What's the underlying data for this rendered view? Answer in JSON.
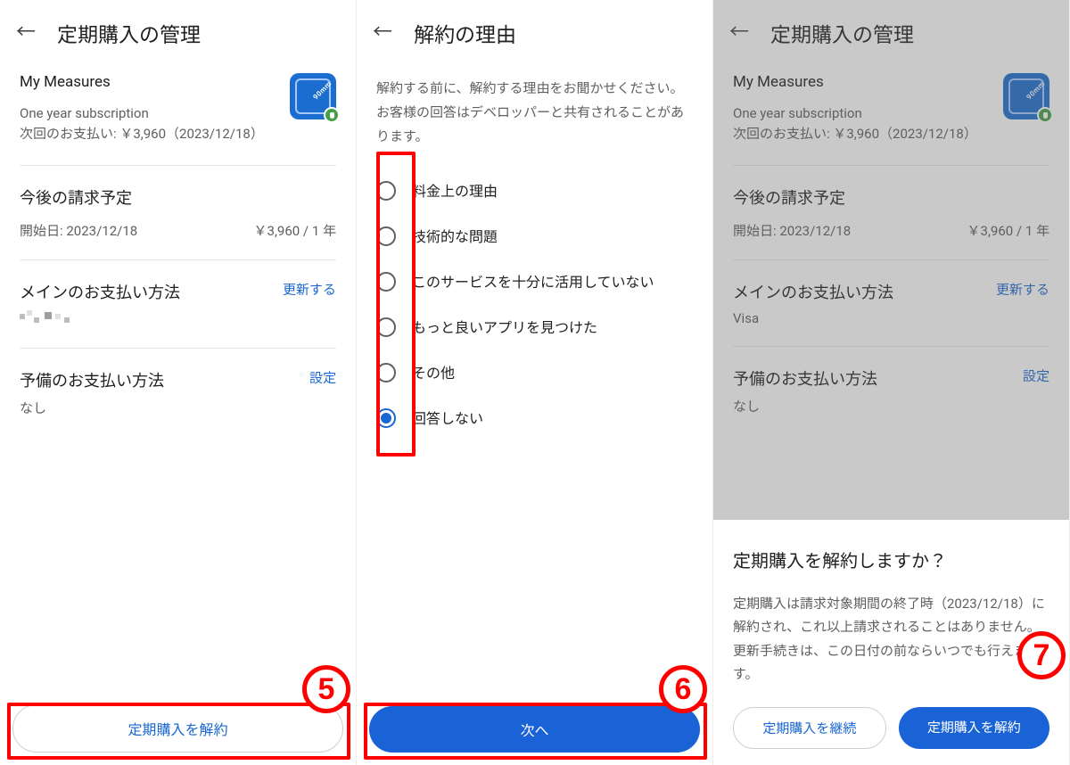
{
  "screen1": {
    "header_title": "定期購入の管理",
    "app_name": "My Measures",
    "app_sub1": "One year subscription",
    "app_sub2": "次回のお支払い: ￥3,960（2023/12/18）",
    "billing_title": "今後の請求予定",
    "billing_start_label": "開始日: 2023/12/18",
    "billing_price": "￥3,960 / 1 年",
    "payment_title": "メインのお支払い方法",
    "payment_update": "更新する",
    "backup_title": "予備のお支払い方法",
    "backup_value": "なし",
    "backup_set": "設定",
    "cancel_btn": "定期購入を解約",
    "callout_number": "5"
  },
  "screen2": {
    "header_title": "解約の理由",
    "desc": "解約する前に、解約する理由をお聞かせください。お客様の回答はデベロッパーと共有されることがあります。",
    "options": [
      "料金上の理由",
      "技術的な問題",
      "このサービスを十分に活用していない",
      "もっと良いアプリを見つけた",
      "その他",
      "回答しない"
    ],
    "selected_index": 5,
    "next_btn": "次へ",
    "callout_number": "6"
  },
  "screen3": {
    "header_title": "定期購入の管理",
    "app_name": "My Measures",
    "app_sub1": "One year subscription",
    "app_sub2": "次回のお支払い: ￥3,960（2023/12/18）",
    "billing_title": "今後の請求予定",
    "billing_start_label": "開始日: 2023/12/18",
    "billing_price": "￥3,960 / 1 年",
    "payment_title": "メインのお支払い方法",
    "payment_value": "Visa",
    "payment_update": "更新する",
    "backup_title": "予備のお支払い方法",
    "backup_value": "なし",
    "backup_set": "設定",
    "sheet_title": "定期購入を解約しますか？",
    "sheet_body": "定期購入は請求対象期間の終了時（2023/12/18）に解約され、これ以上請求されることはありません。更新手続きは、この日付の前ならいつでも行えます。",
    "continue_btn": "定期購入を継続",
    "cancel_btn": "定期購入を解約",
    "callout_number": "7"
  }
}
